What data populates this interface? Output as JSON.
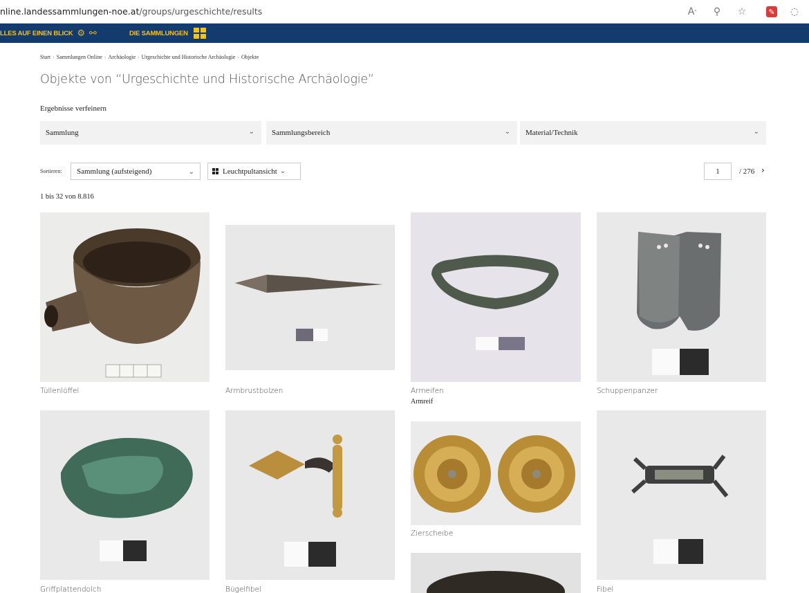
{
  "browser": {
    "url_host": "nline.landessammlungen-noe.at",
    "url_path": "/groups/urgeschichte/results",
    "icons": [
      "read-aloud-icon",
      "zoom-icon",
      "favorite-star-icon",
      "extension-icon",
      "copilot-icon"
    ]
  },
  "nav": {
    "overview_label": "LLES AUF EINEN BLICK",
    "collections_label": "DIE SAMMLUNGEN",
    "accent_color": "#f4c21f",
    "bar_color": "#143b6e"
  },
  "breadcrumb": [
    "Start",
    "Sammlungen Online",
    "Archäologie",
    "Urgeschichte und Historische Archäologie",
    "Objekte"
  ],
  "page_title": "Objekte von “Urgeschichte und Historische Archäologie”",
  "refine_label": "Ergebnisse verfeinern",
  "filters": [
    "Sammlung",
    "Sammlungsbereich",
    "Material/Technik"
  ],
  "sort": {
    "label": "Sortieren:",
    "value": "Sammlung (aufsteigend)",
    "view_value": "Leuchtpultansicht"
  },
  "pagination": {
    "current_page": "1",
    "total": "/ 276",
    "next": "›"
  },
  "result_count": "1 bis 32 von 8.816",
  "items": [
    {
      "title": "Tüllenlöffel",
      "subtitle": ""
    },
    {
      "title": "Armbrustbolzen",
      "subtitle": ""
    },
    {
      "title": "Armeifen",
      "subtitle": "Armreif"
    },
    {
      "title": "Schuppenpanzer",
      "subtitle": ""
    },
    {
      "title": "Griffplattendolch",
      "subtitle": ""
    },
    {
      "title": "Bügelfibel",
      "subtitle": ""
    },
    {
      "title": "Zierscheibe",
      "subtitle": ""
    },
    {
      "title": "",
      "subtitle": ""
    },
    {
      "title": "Fibel",
      "subtitle": ""
    }
  ]
}
